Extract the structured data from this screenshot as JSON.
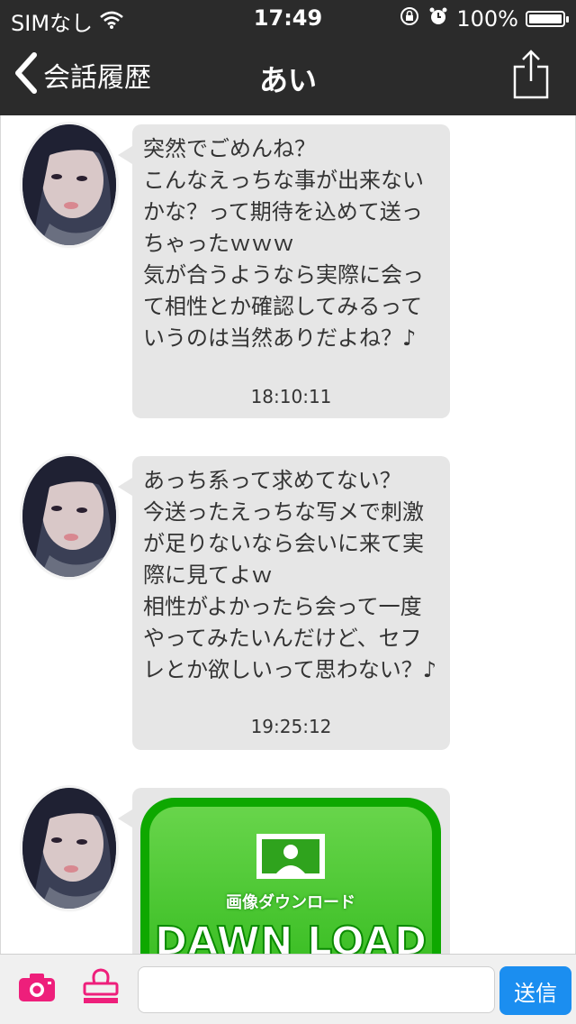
{
  "status_bar": {
    "carrier": "SIMなし",
    "time": "17:49",
    "battery": "100%",
    "battery_level": 1.0
  },
  "nav": {
    "back_label": "会話履歴",
    "title": "あい",
    "back_icon": "chevron-left-icon",
    "share_icon": "share-icon"
  },
  "messages": [
    {
      "text": "突然でごめんね？\nこんなえっちな事が出来ないかな？って期待を込めて送っちゃったｗｗｗ\n気が合うようなら実際に会って相性とか確認してみるっていうのは当然ありだよね？♪",
      "time": "18:10:11"
    },
    {
      "text": "あっち系って求めてない？\n今送ったえっちな写メで刺激が足りないなら会いに来て実際に見てよｗ\n相性がよかったら会って一度やってみたいんだけど、セフレとか欲しいって思わない？♪",
      "time": "19:25:12"
    },
    {
      "download_label": "画像ダウンロード",
      "download_button": "DAWN LOAD"
    }
  ],
  "input": {
    "placeholder": "",
    "send_label": "送信"
  },
  "colors": {
    "bar": "#2b2b2b",
    "bubble": "#e6e6e6",
    "accent_pink": "#ee1f7b",
    "send_blue": "#1b8ef0",
    "download_green": "#2fb81a"
  }
}
